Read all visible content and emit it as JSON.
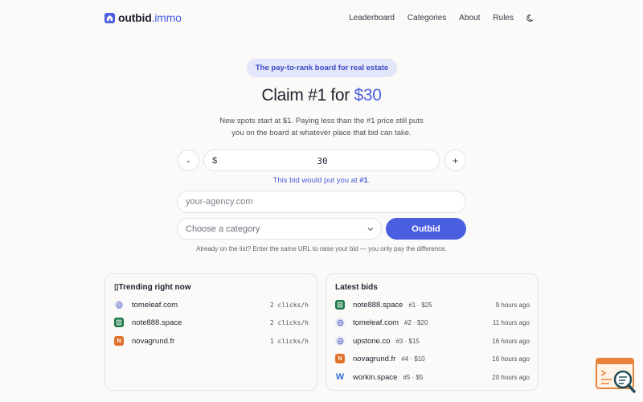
{
  "header": {
    "logo_main": "outbid",
    "logo_accent": ".immo",
    "nav": [
      "Leaderboard",
      "Categories",
      "About",
      "Rules"
    ],
    "theme_icon": "moon-icon"
  },
  "hero": {
    "pill": "The pay-to-rank board for real estate",
    "headline_prefix": "Claim #1 for ",
    "headline_price": "$30",
    "subtext": "New spots start at $1. Paying less than the #1 price still puts you on the board at whatever place that bid can take."
  },
  "bid": {
    "minus_label": "-",
    "plus_label": "+",
    "currency": "$",
    "amount": "30",
    "rank_note_prefix": "This bid would put you at ",
    "rank_note_rank": "#1",
    "rank_note_suffix": ".",
    "url_placeholder": "your-agency.com",
    "category_placeholder": "Choose a category",
    "submit_label": "Outbid",
    "footnote": "Already on the list? Enter the same URL to raise your bid — you only pay the difference."
  },
  "trending": {
    "title": "Trending right now",
    "title_icon": "▯",
    "items": [
      {
        "domain": "tomeleaf.com",
        "rate": "2 clicks/h",
        "icon": "globe-icon"
      },
      {
        "domain": "note888.space",
        "rate": "2 clicks/h",
        "icon": "green-favicon"
      },
      {
        "domain": "novagrund.fr",
        "rate": "1 clicks/h",
        "icon": "orange-favicon"
      }
    ]
  },
  "latest": {
    "title": "Latest bids",
    "items": [
      {
        "domain": "note888.space",
        "meta": "#1 · $25",
        "time": "9 hours ago",
        "icon": "green-favicon"
      },
      {
        "domain": "tomeleaf.com",
        "meta": "#2 · $20",
        "time": "11 hours ago",
        "icon": "globe-icon"
      },
      {
        "domain": "upstone.co",
        "meta": "#3 · $15",
        "time": "16 hours ago",
        "icon": "globe-icon"
      },
      {
        "domain": "novagrund.fr",
        "meta": "#4 · $10",
        "time": "16 hours ago",
        "icon": "orange-favicon"
      },
      {
        "domain": "workin.space",
        "meta": "#5 · $5",
        "time": "20 hours ago",
        "icon": "w-favicon"
      }
    ]
  },
  "colors": {
    "accent": "#4a5ee0",
    "pill_bg": "#e3e5f8",
    "background": "#fbfaf8"
  }
}
